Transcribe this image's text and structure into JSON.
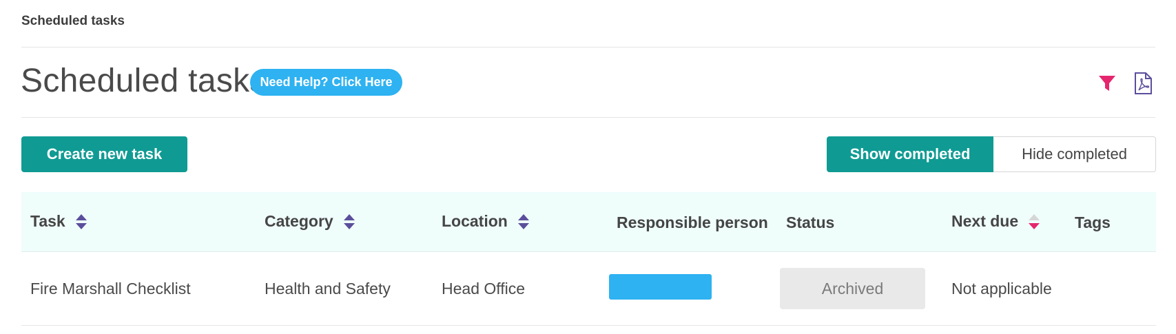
{
  "breadcrumb": "Scheduled tasks",
  "header": {
    "title": "Scheduled tasks",
    "help_label": "Need Help? Click Here",
    "filter_icon": "filter-icon",
    "pdf_icon": "pdf-file-icon"
  },
  "actions": {
    "create_label": "Create new task",
    "show_completed_label": "Show completed",
    "hide_completed_label": "Hide completed",
    "active_toggle": "Show completed"
  },
  "colors": {
    "brand_teal": "#0f9b93",
    "help_blue": "#2eb2f1",
    "sort_purple": "#5b4e9c",
    "sort_active_pink": "#e5266e",
    "header_bg": "#effdfb"
  },
  "table": {
    "columns": [
      {
        "label": "Task",
        "sortable": true,
        "sort_state": "none"
      },
      {
        "label": "Category",
        "sortable": true,
        "sort_state": "none"
      },
      {
        "label": "Location",
        "sortable": true,
        "sort_state": "none"
      },
      {
        "label": "Responsible person",
        "sortable": false
      },
      {
        "label": "Status",
        "sortable": false
      },
      {
        "label": "Next due",
        "sortable": true,
        "sort_state": "descending"
      },
      {
        "label": "Tags",
        "sortable": false
      }
    ],
    "rows": [
      {
        "task": "Fire Marshall Checklist",
        "category": "Health and Safety",
        "location": "Head Office",
        "responsible_person": "",
        "status": "Archived",
        "next_due": "Not applicable",
        "tags": ""
      }
    ]
  }
}
